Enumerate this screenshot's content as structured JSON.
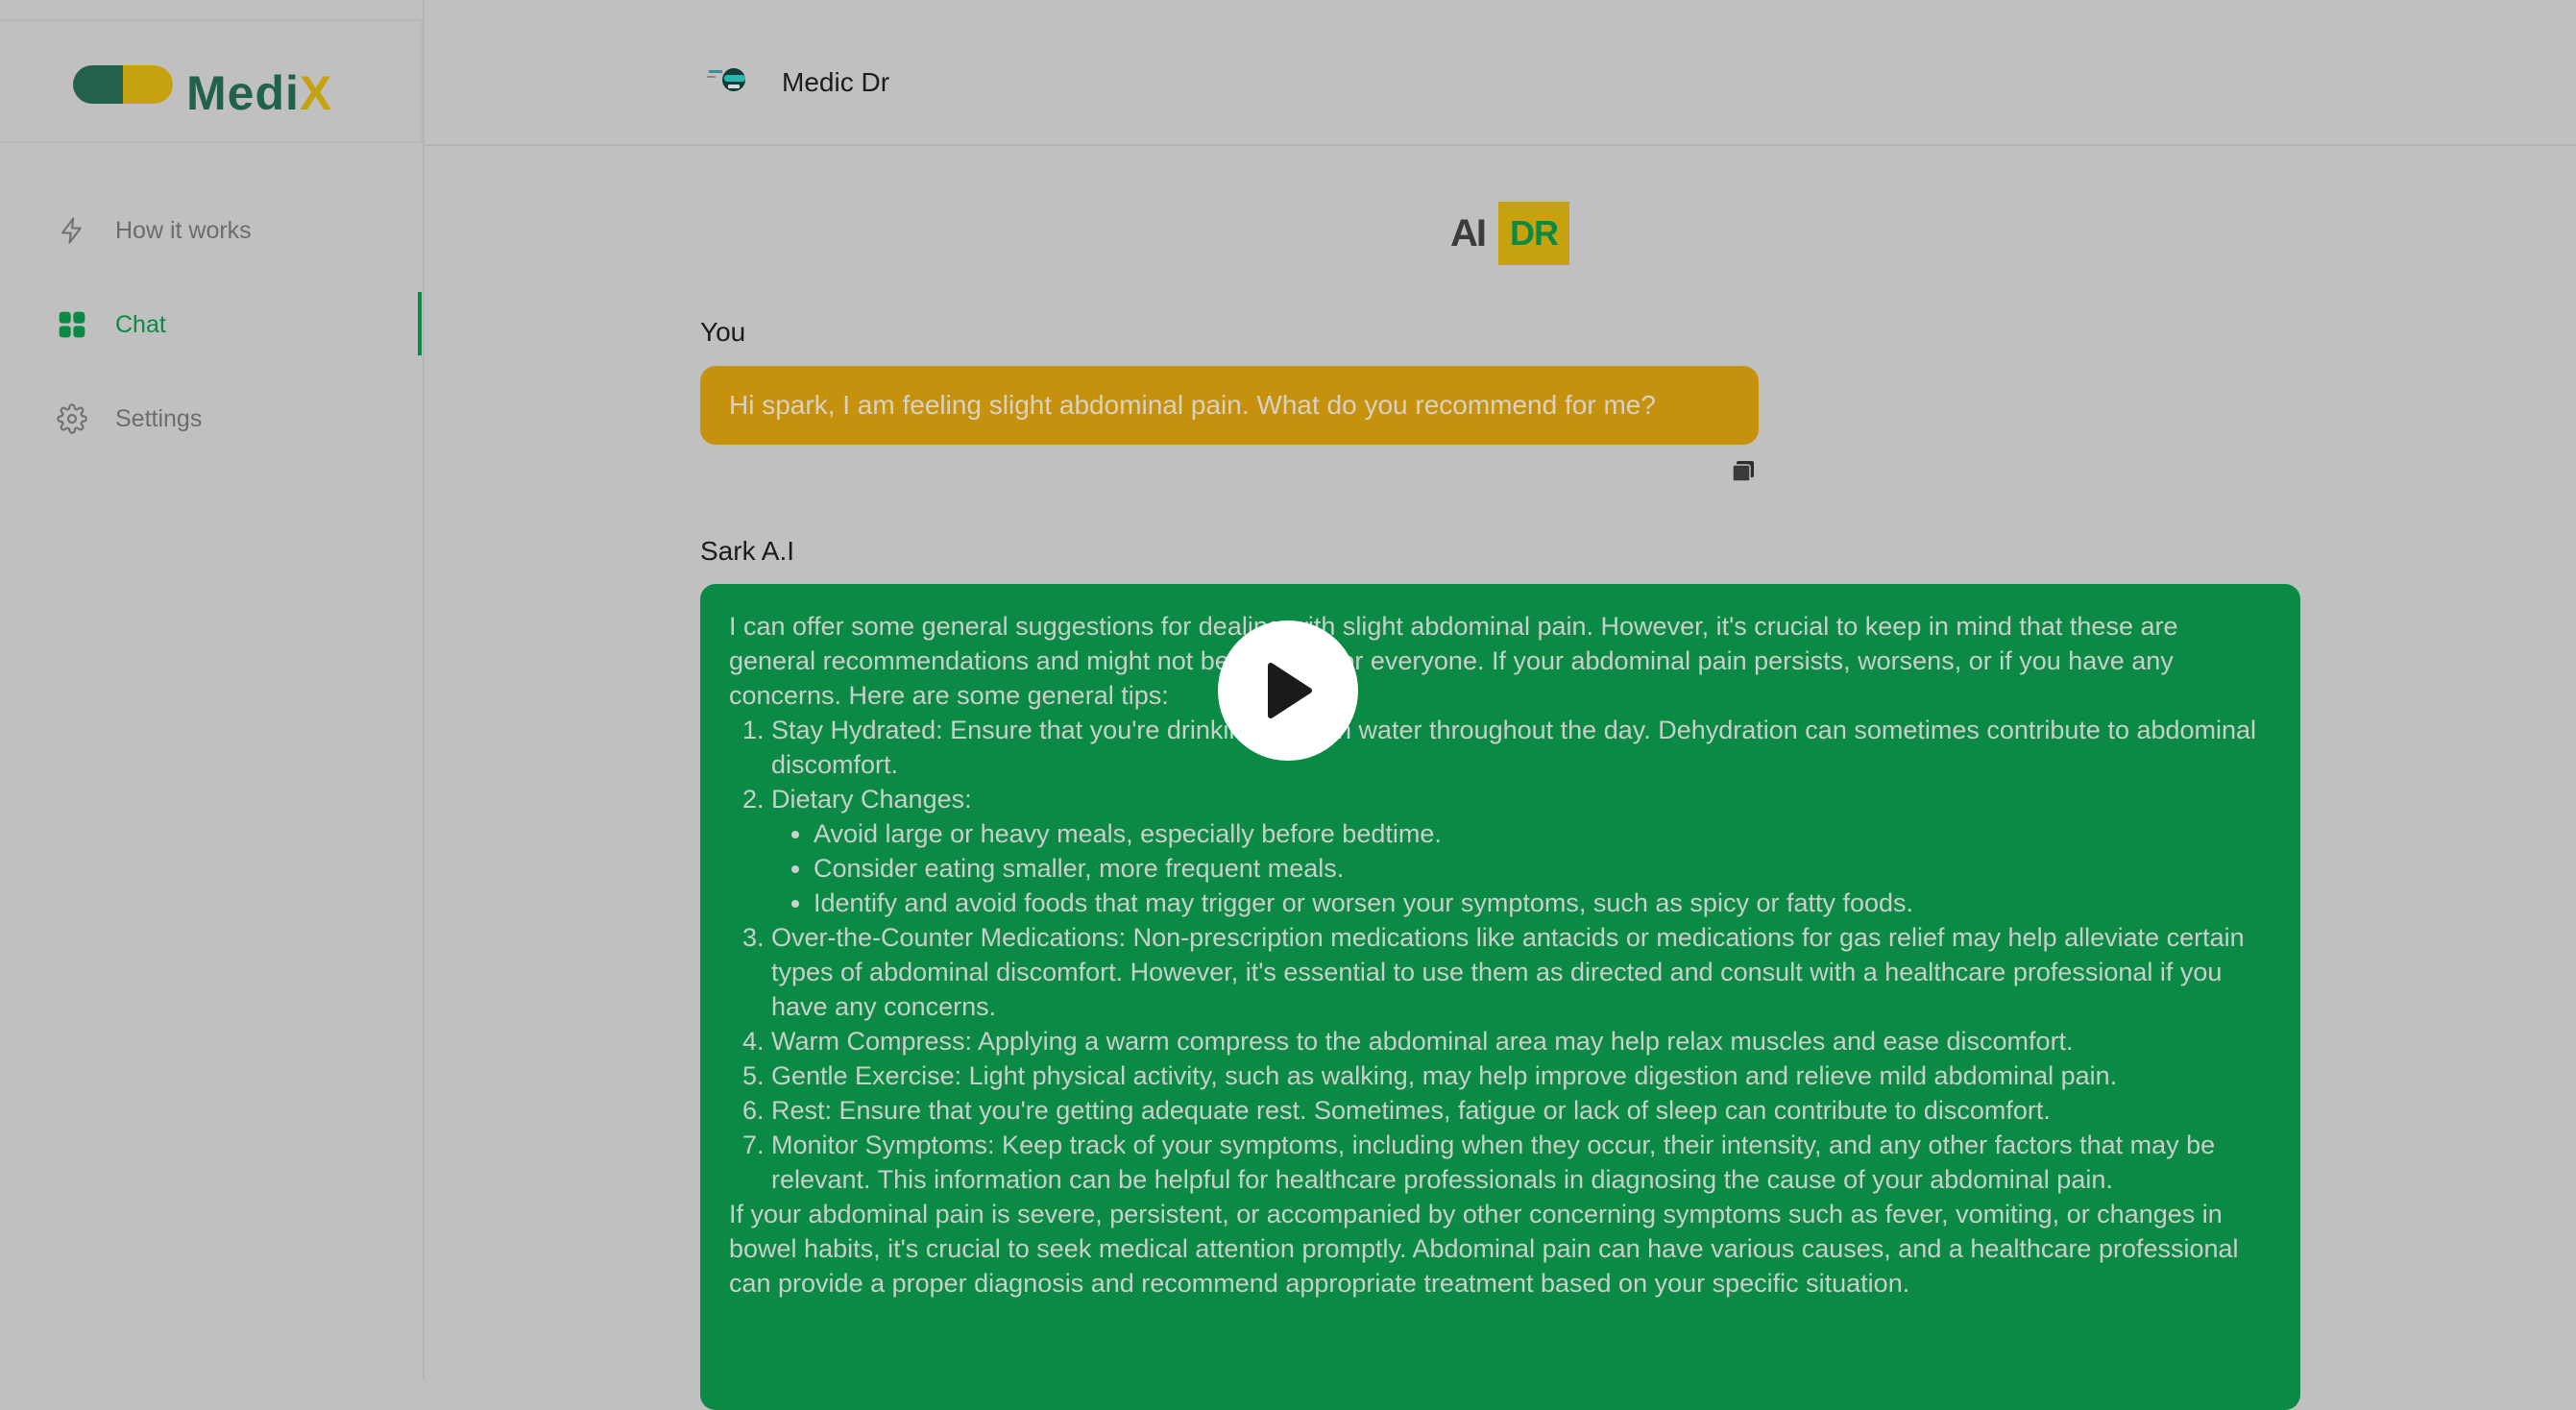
{
  "brand": {
    "name_main": "Medi",
    "name_accent": "X"
  },
  "sidebar": {
    "items": [
      {
        "label": "How it works",
        "icon": "lightning-icon",
        "active": false
      },
      {
        "label": "Chat",
        "icon": "grid-icon",
        "active": true
      },
      {
        "label": "Settings",
        "icon": "gear-icon",
        "active": false
      }
    ]
  },
  "topbar": {
    "title": "Medic Dr",
    "icon": "robot-doctor-icon"
  },
  "badge": {
    "ai": "AI",
    "dr": "DR"
  },
  "chat": {
    "user_label": "You",
    "user_message": "Hi spark, I am feeling slight abdominal pain. What do you recommend for me?",
    "ai_label": "Sark A.I",
    "ai_intro": "I can offer some general suggestions for dealing with slight abdominal pain. However, it's crucial to keep in mind that these are general recommendations and might not be suitable for everyone. If your abdominal pain persists, worsens, or if you have any concerns. Here are some general tips:",
    "tips": [
      "Stay Hydrated: Ensure that you're drinking enough water throughout the day. Dehydration can sometimes contribute to abdominal discomfort.",
      "Dietary Changes:",
      "Over-the-Counter Medications: Non-prescription medications like antacids or medications for gas relief may help alleviate certain types of abdominal discomfort. However, it's essential to use them as directed and consult with a healthcare professional if you have any concerns.",
      "Warm Compress: Applying a warm compress to the abdominal area may help relax muscles and ease discomfort.",
      "Gentle Exercise: Light physical activity, such as walking, may help improve digestion and relieve mild abdominal pain.",
      "Rest: Ensure that you're getting adequate rest. Sometimes, fatigue or lack of sleep can contribute to discomfort.",
      "Monitor Symptoms: Keep track of your symptoms, including when they occur, their intensity, and any other factors that may be relevant. This information can be helpful for healthcare professionals in diagnosing the cause of your abdominal pain."
    ],
    "diet_subtips": [
      "Avoid large or heavy meals, especially before bedtime.",
      "Consider eating smaller, more frequent meals.",
      "Identify and avoid foods that may trigger or worsen your symptoms, such as spicy or fatty foods."
    ],
    "ai_outro": "If your abdominal pain is severe, persistent, or accompanied by other concerning symptoms such as fever, vomiting, or changes in bowel habits, it's crucial to seek medical attention promptly. Abdominal pain can have various causes, and a healthcare professional can provide a proper diagnosis and recommend appropriate treatment based on your specific situation."
  },
  "overlay": {
    "icon": "play-icon"
  },
  "colors": {
    "brand_green": "#23624a",
    "accent_green": "#0b8a45",
    "brand_gold": "#c6a210",
    "user_bubble": "#c6920d"
  }
}
